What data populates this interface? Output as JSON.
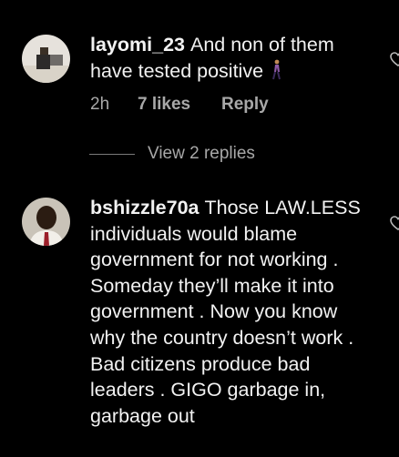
{
  "comments": [
    {
      "username": "layomi_23",
      "text": "And non of them have tested positive",
      "time": "2h",
      "likes": "7 likes",
      "reply_label": "Reply",
      "emoji": "person-walking-emoji"
    },
    {
      "username": "bshizzle70a",
      "text": "Those LAW.LESS individuals would blame government for not working . Someday they’ll make it into government . Now you know why the country doesn’t work . Bad citizens produce bad leaders . GIGO garbage in, garbage out"
    }
  ],
  "view_replies": "View 2 replies",
  "colors": {
    "background": "#000000",
    "text": "#f2f2f2",
    "meta": "#a8a8a8"
  }
}
